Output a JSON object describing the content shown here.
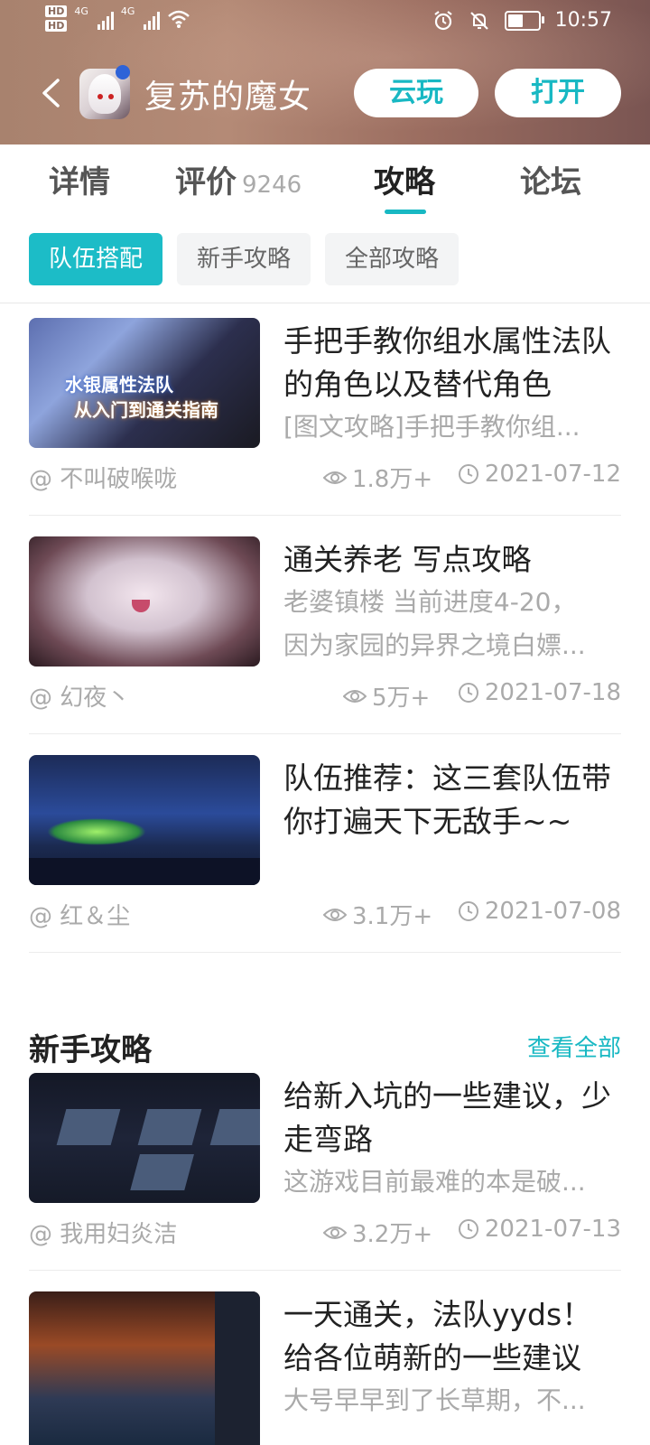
{
  "status_bar": {
    "hd1": "HD",
    "hd2": "HD",
    "net1": "4G",
    "net2": "4G",
    "time": "10:57"
  },
  "app": {
    "title": "复苏的魔女",
    "cloud_play_label": "云玩",
    "open_label": "打开"
  },
  "tabs": [
    {
      "label": "详情",
      "count": ""
    },
    {
      "label": "评价",
      "count": "9246"
    },
    {
      "label": "攻略",
      "count": ""
    },
    {
      "label": "论坛",
      "count": ""
    }
  ],
  "active_tab": "攻略",
  "filter_chips": [
    "队伍搭配",
    "新手攻略",
    "全部攻略"
  ],
  "articles": [
    {
      "title": "手把手教你组水属性法队的角色以及替代角色",
      "desc": "[图文攻略]手把手教你组...",
      "author": "@ 不叫破喉咙",
      "views": "1.8万+",
      "date": "2021-07-12",
      "thumb_text1": "水银属性法队",
      "thumb_text2": "从入门到通关指南"
    },
    {
      "title": "通关养老 写点攻略",
      "desc1": "老婆镇楼 当前进度4-20，",
      "desc2": "因为家园的异界之境白嫖...",
      "author": "@ 幻夜丶",
      "views": "5万+",
      "date": "2021-07-18"
    },
    {
      "title": "队伍推荐：这三套队伍带你打遍天下无敌手~~",
      "author": "@ 红＆尘",
      "views": "3.1万+",
      "date": "2021-07-08"
    }
  ],
  "newbie_section": {
    "title": "新手攻略",
    "see_all": "查看全部",
    "articles": [
      {
        "title": "给新入坑的一些建议，少走弯路",
        "desc": "这游戏目前最难的本是破...",
        "author": "@ 我用妇炎洁",
        "views": "3.2万+",
        "date": "2021-07-13"
      },
      {
        "title": "一天通关，法队yyds！给各位萌新的一些建议",
        "desc": "大号早早到了长草期，不..."
      }
    ]
  },
  "colors": {
    "accent": "#18b8c3",
    "chip_active": "#1cbcc7",
    "meta_gray": "#aaaaaa"
  }
}
